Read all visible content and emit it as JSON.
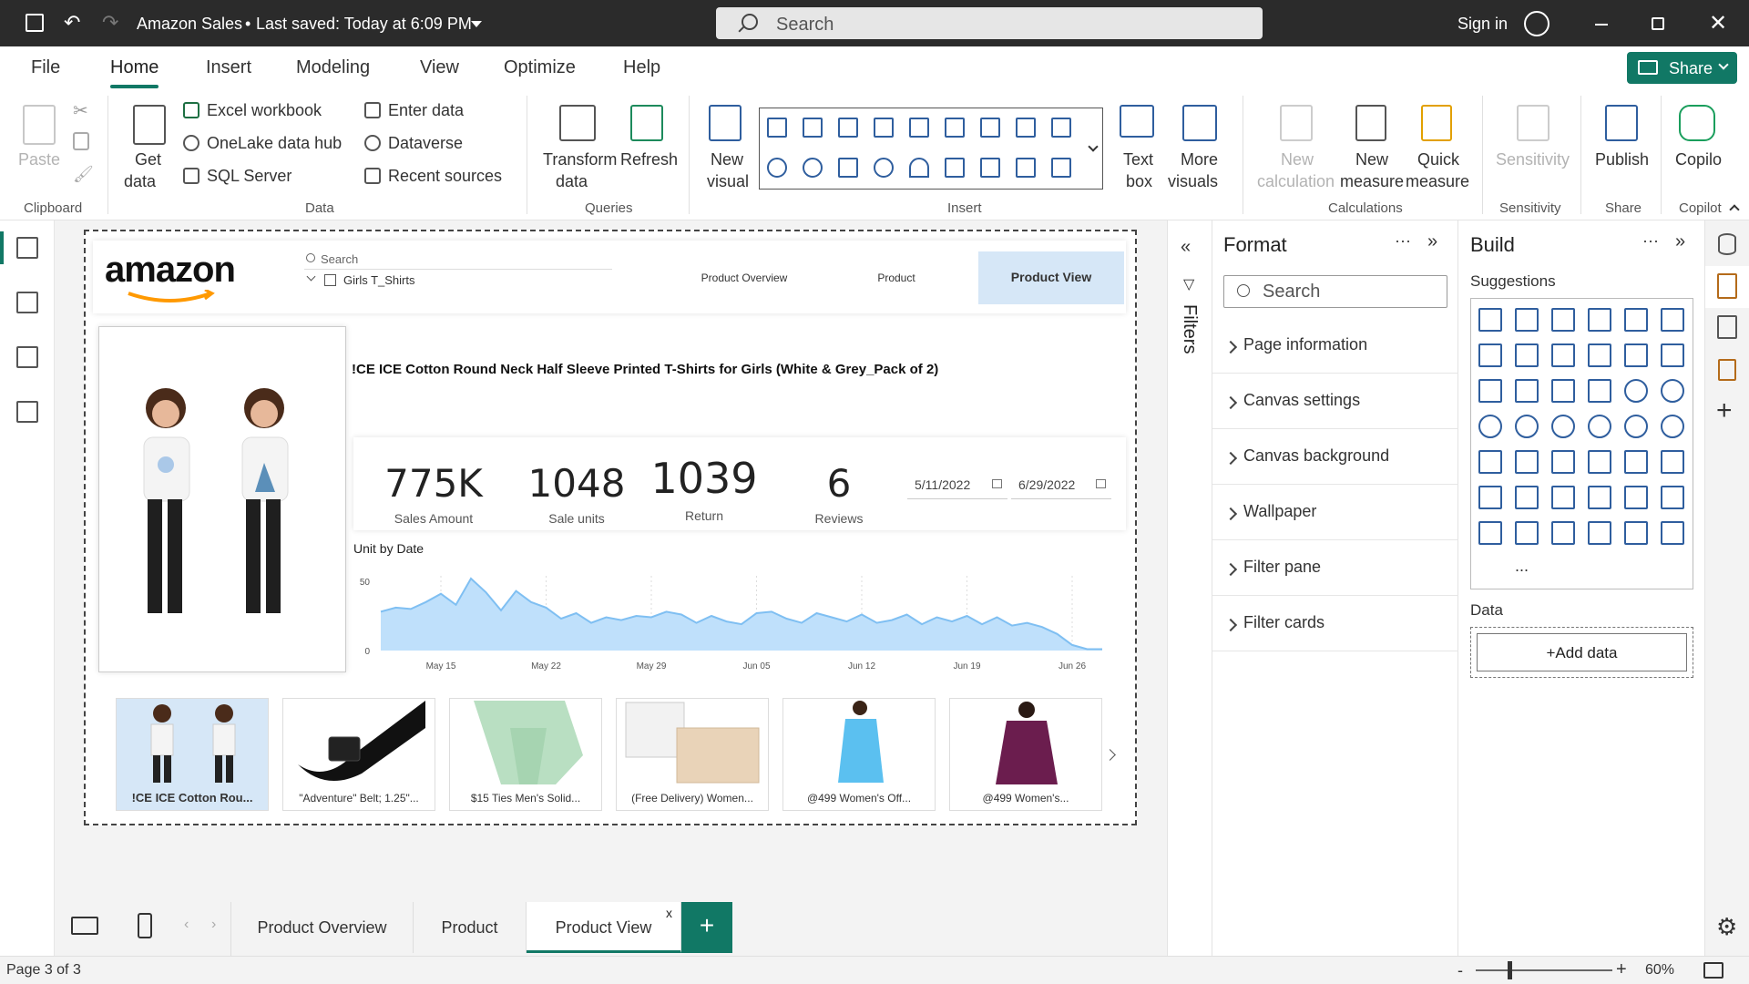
{
  "title_bar": {
    "file_title": "Amazon Sales",
    "saved_text": "Last saved: Today at 6:09 PM",
    "search_placeholder": "Search",
    "sign_in": "Sign in"
  },
  "menu": {
    "items": [
      "File",
      "Home",
      "Insert",
      "Modeling",
      "View",
      "Optimize",
      "Help"
    ],
    "active": "Home",
    "share": "Share"
  },
  "ribbon": {
    "clipboard": {
      "paste": "Paste",
      "group": "Clipboard"
    },
    "data": {
      "get_data_1": "Get",
      "get_data_2": "data",
      "excel": "Excel workbook",
      "onelake": "OneLake data hub",
      "sql": "SQL Server",
      "enter_data": "Enter data",
      "dataverse": "Dataverse",
      "recent": "Recent sources",
      "group": "Data"
    },
    "queries": {
      "transform_1": "Transform",
      "transform_2": "data",
      "refresh": "Refresh",
      "group": "Queries"
    },
    "insert": {
      "new_visual_1": "New",
      "new_visual_2": "visual",
      "text_box_1": "Text",
      "text_box_2": "box",
      "more_visuals_1": "More",
      "more_visuals_2": "visuals",
      "group": "Insert"
    },
    "calculations": {
      "new_calc_1": "New",
      "new_calc_2": "calculation",
      "new_measure_1": "New",
      "new_measure_2": "measure",
      "quick_measure_1": "Quick",
      "quick_measure_2": "measure",
      "group": "Calculations"
    },
    "sensitivity": {
      "label": "Sensitivity",
      "group": "Sensitivity"
    },
    "share": {
      "publish": "Publish",
      "group": "Share"
    },
    "copilot": {
      "label": "Copilo",
      "group": "Copilot"
    }
  },
  "report": {
    "logo": "amazon",
    "slicer": {
      "search_placeholder": "Search",
      "item": "Girls T_Shirts"
    },
    "nav_buttons": [
      "Product Overview",
      "Product",
      "Product View"
    ],
    "active_nav": "Product View",
    "product_title": "!CE ICE Cotton Round Neck Half Sleeve Printed T-Shirts for Girls (White & Grey_Pack of 2)",
    "kpis": [
      {
        "value": "775K",
        "label": "Sales Amount"
      },
      {
        "value": "1048",
        "label": "Sale units"
      },
      {
        "value": "1039",
        "label": "Return"
      },
      {
        "value": "6",
        "label": "Reviews"
      }
    ],
    "date_from": "5/11/2022",
    "date_to": "6/29/2022",
    "thumbnails": [
      "!CE ICE Cotton Rou...",
      "\"Adventure\" Belt; 1.25\"...",
      "$15 Ties Men's Solid...",
      "(Free Delivery) Women...",
      "@499 Women's Off...",
      "@499 Women's..."
    ]
  },
  "chart_data": {
    "type": "area",
    "title": "Unit by Date",
    "x_ticks": [
      "May 15",
      "May 22",
      "May 29",
      "Jun 05",
      "Jun 12",
      "Jun 19",
      "Jun 26"
    ],
    "y_ticks": [
      "50",
      "0"
    ],
    "ylim": [
      0,
      50
    ],
    "x": [
      "May 11",
      "May 12",
      "May 13",
      "May 14",
      "May 15",
      "May 16",
      "May 17",
      "May 18",
      "May 19",
      "May 20",
      "May 21",
      "May 22",
      "May 23",
      "May 24",
      "May 25",
      "May 26",
      "May 27",
      "May 28",
      "May 29",
      "May 30",
      "May 31",
      "Jun 01",
      "Jun 02",
      "Jun 03",
      "Jun 04",
      "Jun 05",
      "Jun 06",
      "Jun 07",
      "Jun 08",
      "Jun 09",
      "Jun 10",
      "Jun 11",
      "Jun 12",
      "Jun 13",
      "Jun 14",
      "Jun 15",
      "Jun 16",
      "Jun 17",
      "Jun 18",
      "Jun 19",
      "Jun 20",
      "Jun 21",
      "Jun 22",
      "Jun 23",
      "Jun 24",
      "Jun 25",
      "Jun 26",
      "Jun 27",
      "Jun 28"
    ],
    "series": [
      {
        "values": [
          28,
          31,
          30,
          35,
          41,
          33,
          52,
          42,
          29,
          43,
          35,
          31,
          23,
          27,
          20,
          24,
          22,
          25,
          24,
          28,
          26,
          20,
          25,
          21,
          19,
          27,
          28,
          23,
          20,
          27,
          24,
          21,
          26,
          20,
          22,
          26,
          19,
          24,
          21,
          25,
          19,
          24,
          18,
          20,
          17,
          12,
          4,
          1,
          1
        ]
      }
    ],
    "color": "#7fbff2"
  },
  "filters_label": "Filters",
  "format_pane": {
    "title": "Format",
    "search_placeholder": "Search",
    "sections": [
      "Page information",
      "Canvas settings",
      "Canvas background",
      "Wallpaper",
      "Filter pane",
      "Filter cards"
    ]
  },
  "build_pane": {
    "title": "Build",
    "suggestions": "Suggestions",
    "data_label": "Data",
    "add_data": "+Add data",
    "more": "..."
  },
  "tabs": {
    "items": [
      "Product Overview",
      "Product",
      "Product View"
    ],
    "active": "Product View",
    "close": "x",
    "add": "+"
  },
  "status": {
    "page": "Page 3 of 3",
    "zoom": "60%",
    "minus": "-",
    "plus": "+"
  },
  "colors": {
    "accent": "#117865",
    "nav_active": "#d6e7f7",
    "area_fill": "#bfe0fb",
    "area_line": "#7fbff2"
  }
}
